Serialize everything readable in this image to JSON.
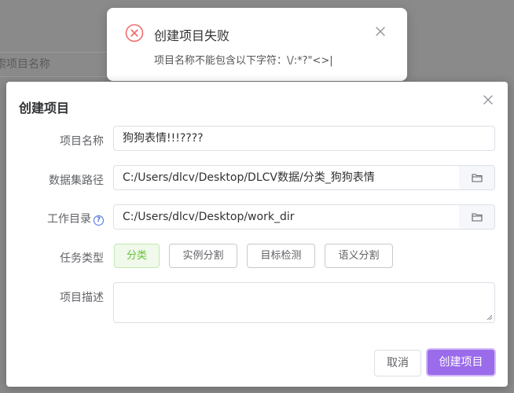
{
  "background": {
    "search_placeholder": "索项目名称"
  },
  "notification": {
    "title": "创建项目失败",
    "message": "项目名称不能包含以下字符：\\/:*?\"<>|",
    "icon": "error-circle-icon",
    "color": "#f56c6c"
  },
  "dialog": {
    "title": "创建项目",
    "fields": {
      "name_label": "项目名称",
      "name_value": "狗狗表情!!!????",
      "dataset_label": "数据集路径",
      "dataset_value": "C:/Users/dlcv/Desktop/DLCV数据/分类_狗狗表情",
      "workdir_label": "工作目录",
      "workdir_value": "C:/Users/dlcv/Desktop/work_dir",
      "task_label": "任务类型",
      "desc_label": "项目描述"
    },
    "task_types": [
      "分类",
      "实例分割",
      "目标检测",
      "语义分割"
    ],
    "selected_task": "分类",
    "cancel_label": "取消",
    "create_label": "创建项目",
    "accent_color": "#9a6bea"
  }
}
